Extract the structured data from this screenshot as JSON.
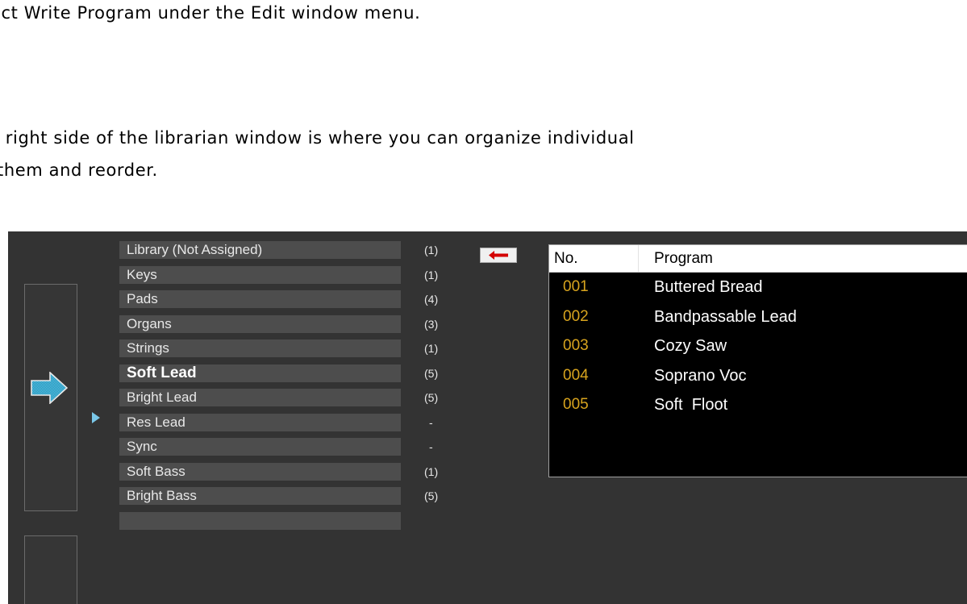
{
  "document": {
    "line1": "ect Write Program under the Edit window menu.",
    "line2": "e right side of the librarian window is where you can organize individual",
    "line3": "them and reorder."
  },
  "librarian": {
    "categories": [
      {
        "label": "Library (Not Assigned)",
        "count": "(1)"
      },
      {
        "label": "Keys",
        "count": "(1)"
      },
      {
        "label": "Pads",
        "count": "(4)"
      },
      {
        "label": "Organs",
        "count": "(3)"
      },
      {
        "label": "Strings",
        "count": "(1)"
      },
      {
        "label": "Soft Lead",
        "count": "(5)",
        "selected": true
      },
      {
        "label": "Bright Lead",
        "count": "(5)"
      },
      {
        "label": "Res Lead",
        "count": "-"
      },
      {
        "label": "Sync",
        "count": "-"
      },
      {
        "label": "Soft Bass",
        "count": "(1)"
      },
      {
        "label": "Bright Bass",
        "count": "(5)"
      },
      {
        "label": "",
        "count": ""
      }
    ],
    "program_list": {
      "headers": {
        "number": "No.",
        "program": "Program"
      },
      "rows": [
        {
          "number": "001",
          "name": "Buttered Bread"
        },
        {
          "number": "002",
          "name": "Bandpassable Lead"
        },
        {
          "number": "003",
          "name": "Cozy Saw"
        },
        {
          "number": "004",
          "name": "Soprano Voc"
        },
        {
          "number": "005",
          "name": "Soft  Floot"
        }
      ]
    },
    "icons": {
      "move_arrow": "right-arrow-icon",
      "selection_marker": "triangle-right-icon",
      "back_button": "left-arrow-icon"
    },
    "colors": {
      "background": "#333333",
      "category_button": "#4d4d4d",
      "program_number": "#d8a41e",
      "move_arrow_fill": "#29a3c8",
      "back_arrow": "#d40000",
      "selection_marker": "#7ac7e8"
    }
  }
}
